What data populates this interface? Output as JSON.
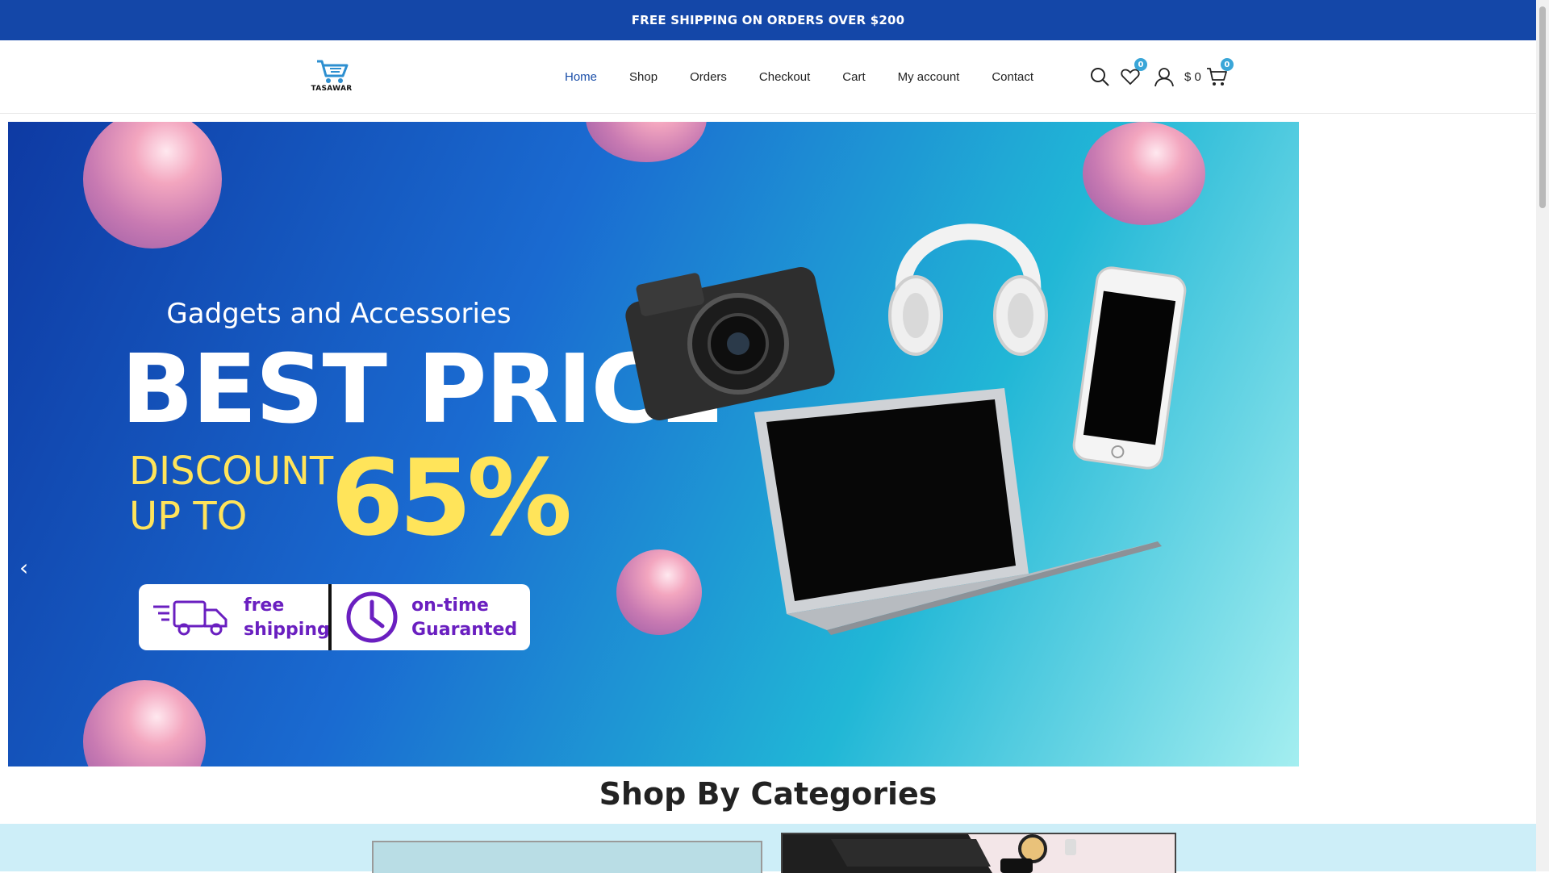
{
  "topbar": {
    "text": "FREE SHIPPING ON ORDERS OVER $200"
  },
  "logo": {
    "text": "TASAWAR"
  },
  "nav": {
    "items": [
      {
        "label": "Home",
        "active": true
      },
      {
        "label": "Shop"
      },
      {
        "label": "Orders"
      },
      {
        "label": "Checkout"
      },
      {
        "label": "Cart"
      },
      {
        "label": "My account"
      },
      {
        "label": "Contact"
      }
    ]
  },
  "header_icons": {
    "search": "search-icon",
    "wishlist": {
      "icon": "heart-icon",
      "count": "0"
    },
    "account": "user-icon",
    "cart": {
      "icon": "cart-icon",
      "price": "$ 0",
      "count": "0"
    }
  },
  "hero": {
    "subtitle": "Gadgets and Accessories",
    "title": "BEST PRICE",
    "discount_line1": "DISCOUNT",
    "discount_line2": "UP TO",
    "discount_value": "65%",
    "badge1_line1": "free",
    "badge1_line2": "shipping",
    "badge2_line1": "on-time",
    "badge2_line2": "Guaranted",
    "prev_arrow": "‹",
    "next_arrow": "›"
  },
  "categories": {
    "title": "Shop By Categories"
  },
  "colors": {
    "topbar": "#1447a8",
    "nav_active": "#1a4ea8",
    "badge": "#3aa6d8",
    "hero_yellow": "#ffe45a",
    "badge_purple": "#6a1fc0"
  }
}
